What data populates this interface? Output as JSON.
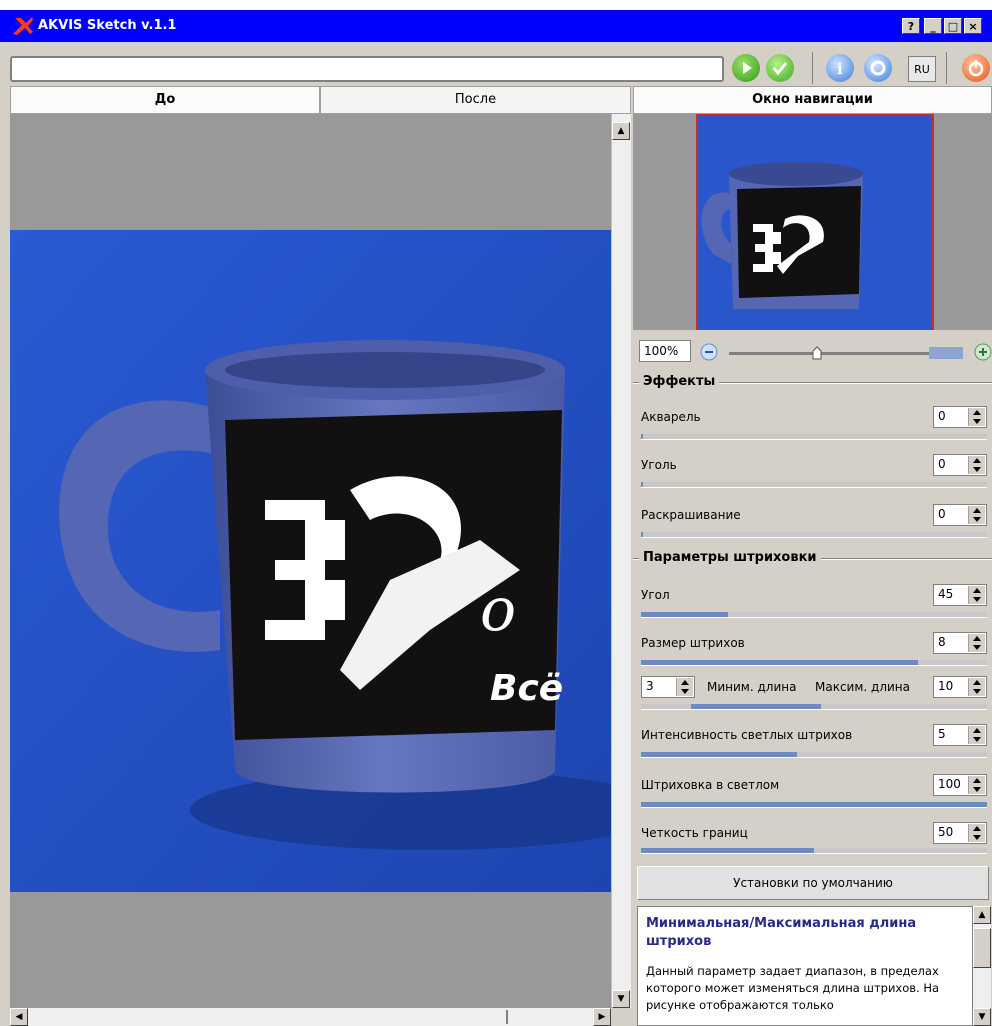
{
  "window": {
    "title": "AKVIS Sketch v.1.1",
    "controls": {
      "help": "?",
      "minimize": "_",
      "maximize": "□",
      "close": "×"
    }
  },
  "toolbar": {
    "path_value": "",
    "lang": "RU",
    "icons": [
      "run-icon",
      "apply-icon",
      "info-icon",
      "help-icon",
      "power-icon"
    ]
  },
  "tabs": {
    "before": "До",
    "after": "После"
  },
  "canvas": {
    "image": "blue mug photo",
    "mug_text": "Всё",
    "mug_number": "39"
  },
  "navigator": {
    "title": "Окно навигации",
    "zoom": "100%",
    "zoom_slider_position": 0.36
  },
  "effects": {
    "title": "Эффекты",
    "items": [
      {
        "label": "Акварель",
        "value": "0",
        "fill": 0.0
      },
      {
        "label": "Уголь",
        "value": "0",
        "fill": 0.0
      },
      {
        "label": "Раскрашивание",
        "value": "0",
        "fill": 0.0
      }
    ]
  },
  "hatching": {
    "title": "Параметры штриховки",
    "angle": {
      "label": "Угол",
      "value": "45",
      "fill": 0.25
    },
    "stroke_size": {
      "label": "Размер штрихов",
      "value": "8",
      "fill": 0.8
    },
    "length": {
      "min_value": "3",
      "min_label": "Миним. длина",
      "max_label": "Максим. длина",
      "max_value": "10"
    },
    "light_intensity": {
      "label": "Интенсивность светлых штрихов",
      "value": "5",
      "fill": 0.45
    },
    "light_hatching": {
      "label": "Штриховка в светлом",
      "value": "100",
      "fill": 1.0
    },
    "edge_sharpness": {
      "label": "Четкость границ",
      "value": "50",
      "fill": 0.5
    }
  },
  "default_button": "Установки по умолчанию",
  "help": {
    "heading": "Минимальная/Максимальная длина штрихов",
    "body": "Данный параметр задает диапазон, в пределах которого может изменяться длина штрихов. На рисунке отображаются только"
  }
}
